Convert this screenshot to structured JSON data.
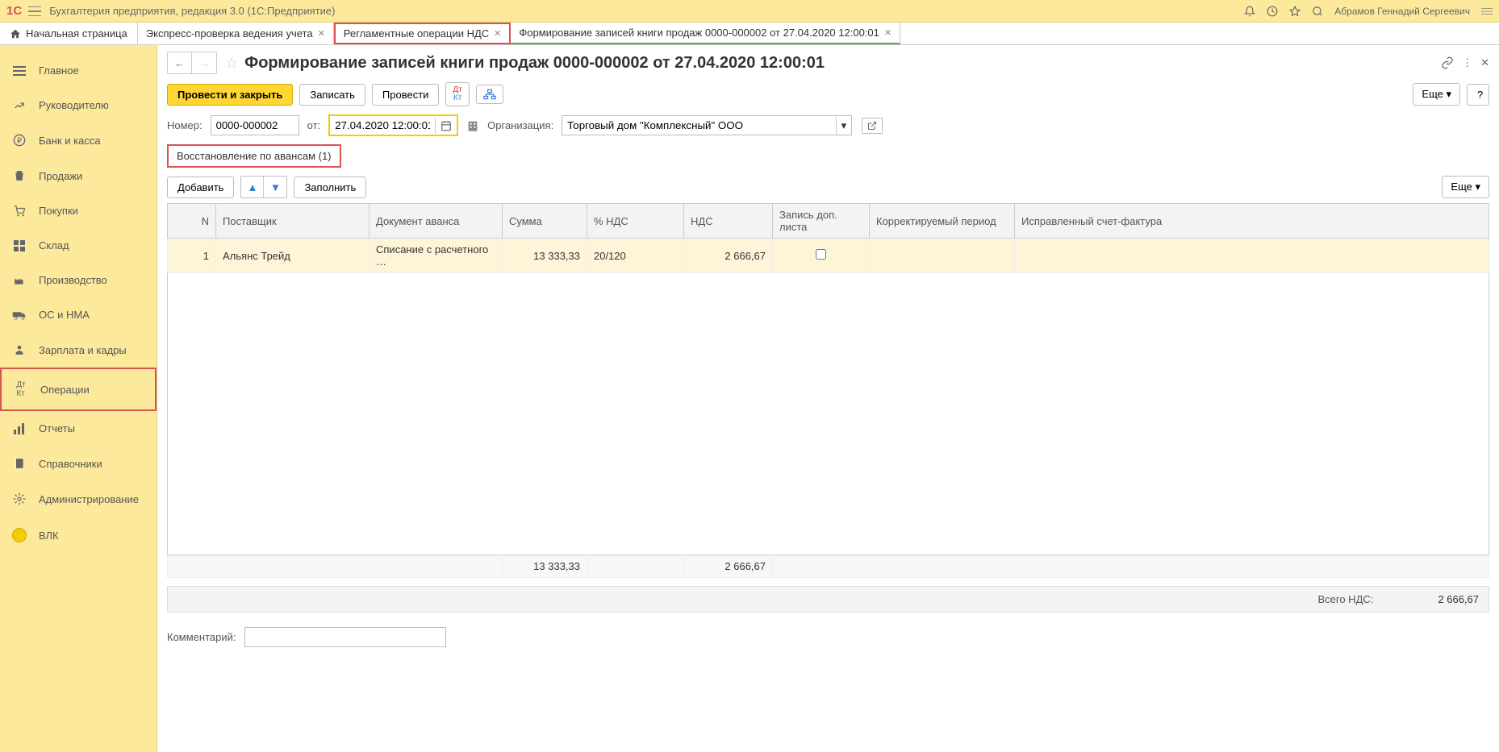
{
  "header": {
    "app_title": "Бухгалтерия предприятия, редакция 3.0   (1С:Предприятие)",
    "user_name": "Абрамов Геннадий Сергеевич"
  },
  "tabs": {
    "home": "Начальная страница",
    "items": [
      {
        "label": "Экспресс-проверка ведения учета"
      },
      {
        "label": "Регламентные операции НДС"
      },
      {
        "label": "Формирование записей книги продаж 0000-000002 от 27.04.2020 12:00:01"
      }
    ]
  },
  "sidebar": {
    "items": [
      {
        "label": "Главное"
      },
      {
        "label": "Руководителю"
      },
      {
        "label": "Банк и касса"
      },
      {
        "label": "Продажи"
      },
      {
        "label": "Покупки"
      },
      {
        "label": "Склад"
      },
      {
        "label": "Производство"
      },
      {
        "label": "ОС и НМА"
      },
      {
        "label": "Зарплата и кадры"
      },
      {
        "label": "Операции"
      },
      {
        "label": "Отчеты"
      },
      {
        "label": "Справочники"
      },
      {
        "label": "Администрирование"
      },
      {
        "label": "ВЛК"
      }
    ]
  },
  "document": {
    "title": "Формирование записей книги продаж 0000-000002 от 27.04.2020 12:00:01",
    "btn_save_close": "Провести и закрыть",
    "btn_save": "Записать",
    "btn_post": "Провести",
    "btn_more": "Еще",
    "number_label": "Номер:",
    "number_value": "0000-000002",
    "date_label": "от:",
    "date_value": "27.04.2020 12:00:01",
    "org_label": "Организация:",
    "org_value": "Торговый дом \"Комплексный\" ООО",
    "sub_tab": "Восстановление по авансам (1)",
    "btn_add": "Добавить",
    "btn_fill": "Заполнить",
    "table": {
      "headers": {
        "n": "N",
        "supplier": "Поставщик",
        "doc": "Документ аванса",
        "sum": "Сумма",
        "vat_pct": "% НДС",
        "vat": "НДС",
        "extra_sheet": "Запись доп. листа",
        "corr_period": "Корректируемый период",
        "corr_invoice": "Исправленный счет-фактура"
      },
      "rows": [
        {
          "n": "1",
          "supplier": "Альянс Трейд",
          "doc": "Списание с расчетного …",
          "sum": "13 333,33",
          "vat_pct": "20/120",
          "vat": "2 666,67",
          "extra_sheet_checked": false
        }
      ],
      "footer": {
        "sum": "13 333,33",
        "vat": "2 666,67"
      }
    },
    "total_vat_label": "Всего НДС:",
    "total_vat_value": "2 666,67",
    "comment_label": "Комментарий:",
    "comment_value": ""
  }
}
